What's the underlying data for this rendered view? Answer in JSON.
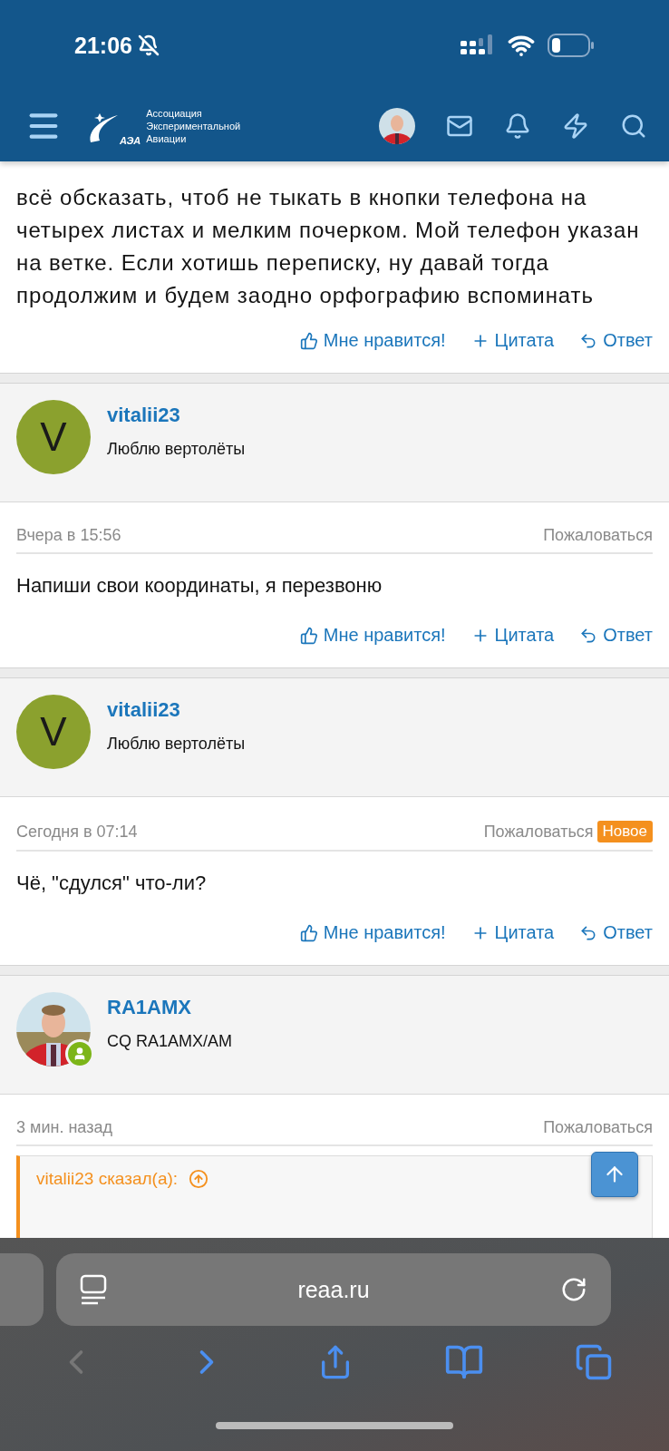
{
  "status_bar": {
    "time": "21:06",
    "silent": true
  },
  "site_header": {
    "logo_mark": "АЭА",
    "logo_lines": [
      "Ассоциация",
      "Экспериментальной",
      "Авиации"
    ]
  },
  "top_post": {
    "body": "всё обсказать, чтоб не тыкать в кнопки телефона на четырех листах и мелким почерком. Мой телефон указан на ветке. Если хотишь переписку, ну давай тогда продолжим и будем заодно орфографию вспоминать",
    "actions": [
      {
        "kind": "like",
        "label": "Мне нравится!"
      },
      {
        "kind": "quote",
        "label": "Цитата"
      },
      {
        "kind": "reply",
        "label": "Ответ"
      }
    ]
  },
  "posts": [
    {
      "author": "vitalii23",
      "user_title": "Люблю вертолёты",
      "avatar": {
        "kind": "letter",
        "letter": "V",
        "color": "#8ba12e"
      },
      "online": false,
      "time": "Вчера в 15:56",
      "report": "Пожаловаться",
      "body": "Напиши свои координаты, я перезвоню",
      "actions": [
        {
          "kind": "like",
          "label": "Мне нравится!"
        },
        {
          "kind": "quote",
          "label": "Цитата"
        },
        {
          "kind": "reply",
          "label": "Ответ"
        }
      ]
    },
    {
      "author": "vitalii23",
      "user_title": "Люблю вертолёты",
      "avatar": {
        "kind": "letter",
        "letter": "V",
        "color": "#8ba12e"
      },
      "online": false,
      "time": "Сегодня в 07:14",
      "report": "Пожаловаться",
      "badge": "Новое",
      "body": "Чё, \"сдулся\" что-ли?",
      "actions": [
        {
          "kind": "like",
          "label": "Мне нравится!"
        },
        {
          "kind": "quote",
          "label": "Цитата"
        },
        {
          "kind": "reply",
          "label": "Ответ"
        }
      ]
    },
    {
      "author": "RA1AMX",
      "user_title": "CQ RA1AMX/AM",
      "online": true,
      "time": "3 мин. назад",
      "report": "Пожаловаться",
      "quote": {
        "source": "vitalii23 сказал(а):"
      }
    }
  ],
  "browser": {
    "url": "reaa.ru",
    "back_disabled": true,
    "forward_disabled": false
  }
}
